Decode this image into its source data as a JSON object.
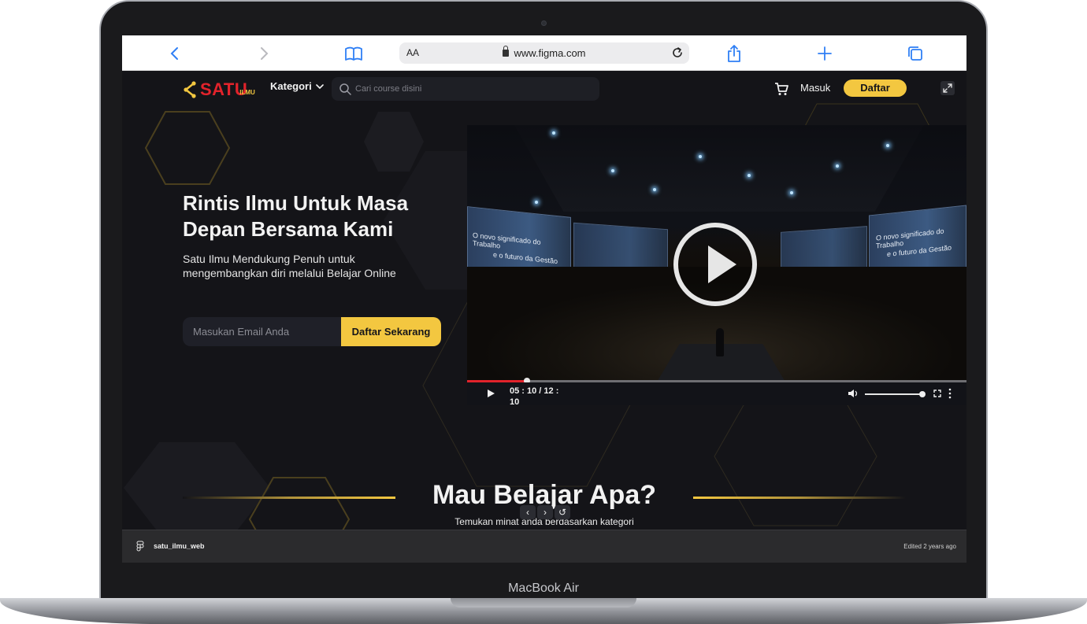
{
  "device": {
    "label": "MacBook Air"
  },
  "browser": {
    "text_size_label": "AA",
    "url": "www.figma.com"
  },
  "site": {
    "logo": {
      "word": "SATU",
      "sub": "ILMU"
    },
    "nav": {
      "category_label": "Kategori",
      "search_placeholder": "Cari course disini",
      "login_label": "Masuk",
      "register_label": "Daftar"
    },
    "hero": {
      "title": "Rintis Ilmu Untuk Masa Depan Bersama Kami",
      "subtitle": "Satu Ilmu Mendukung Penuh untuk mengembangkan diri melalui Belajar Online",
      "email_placeholder": "Masukan Email Anda",
      "cta_label": "Daftar Sekarang"
    },
    "video": {
      "time_label": "05 : 10 / 12 : 10",
      "progress": 0.12,
      "screen_left_line1": "O novo significado do Trabalho",
      "screen_left_line2": "e o futuro da Gestão",
      "screen_right_line1": "O novo significado do Trabalho",
      "screen_right_line2": "e o futuro da Gestão"
    },
    "section": {
      "title": "Mau Belajar Apa?",
      "subtitle": "Temukan minat anda berdasarkan kategori"
    }
  },
  "prototype": {
    "prev": "‹",
    "next": "›",
    "restart": "↺"
  },
  "figma": {
    "file_name": "satu_ilmu_web",
    "edited": "Edited 2 years ago"
  },
  "colors": {
    "accent": "#f3c740",
    "brand_red": "#e2232b",
    "background": "#141418",
    "safari_blue": "#2f7ff5"
  }
}
